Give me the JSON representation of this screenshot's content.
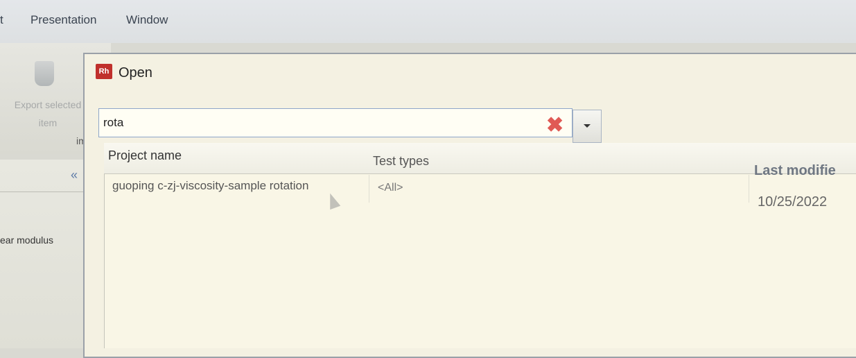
{
  "menubar": {
    "items": [
      "t",
      "Presentation",
      "Window"
    ]
  },
  "ribbon": {
    "export_label": "Export selected item",
    "import_label": "im"
  },
  "side_panel": {
    "collapse_icon": "«",
    "modulus_label": "ear modulus"
  },
  "dialog": {
    "icon_text": "Rh",
    "title": "Open",
    "search": {
      "value": "rota",
      "clear_icon": "✖"
    },
    "table": {
      "headers": [
        "Project name",
        "Test types",
        "Last modifie"
      ],
      "rows": [
        {
          "project": "guoping c-zj-viscosity-sample rotation",
          "types": "<All>",
          "modified": "10/25/2022"
        }
      ]
    }
  },
  "colors": {
    "dialog_bg": "#f4f1e2",
    "icon_red": "#c0302c",
    "clear_red": "#e05a55",
    "accent_border": "#8ea6c9"
  }
}
